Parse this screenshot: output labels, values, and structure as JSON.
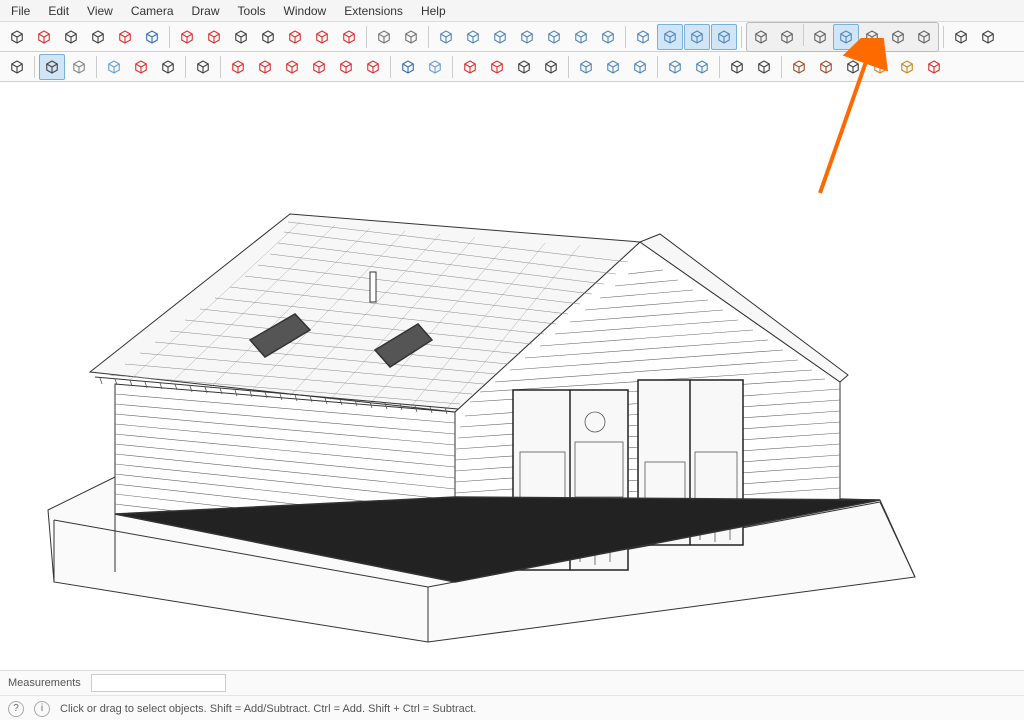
{
  "menu": [
    "File",
    "Edit",
    "View",
    "Camera",
    "Draw",
    "Tools",
    "Window",
    "Extensions",
    "Help"
  ],
  "toolbar1": [
    {
      "name": "select-tool",
      "color": "#444"
    },
    {
      "name": "eraser-crossed-tool",
      "color": "#d33"
    },
    {
      "name": "freehand-tool",
      "color": "#444"
    },
    {
      "name": "text-box-tool",
      "color": "#444"
    },
    {
      "name": "target-tool",
      "color": "#d33"
    },
    {
      "name": "text-a-tool",
      "color": "#3a6fb7"
    },
    {
      "sep": true
    },
    {
      "name": "rotate-prev-tool",
      "color": "#d33"
    },
    {
      "name": "rotate-next-tool",
      "color": "#d33"
    },
    {
      "name": "zoom-in-tool",
      "color": "#444"
    },
    {
      "name": "zoom-target-tool",
      "color": "#444"
    },
    {
      "name": "zoom-extents-tool",
      "color": "#d33"
    },
    {
      "name": "lock-view-tool",
      "color": "#d33"
    },
    {
      "name": "lock-extents-tool",
      "color": "#d33"
    },
    {
      "sep": true
    },
    {
      "name": "walk-tool",
      "color": "#777"
    },
    {
      "name": "person-tool",
      "color": "#777"
    },
    {
      "sep": true
    },
    {
      "name": "cube-tool",
      "color": "#5588bb"
    },
    {
      "name": "panel-tool",
      "color": "#5588bb"
    },
    {
      "name": "house-tool",
      "color": "#5588bb"
    },
    {
      "name": "window-tool",
      "color": "#5588bb"
    },
    {
      "name": "calendar-tool",
      "color": "#5588bb"
    },
    {
      "name": "page-tool",
      "color": "#5588bb"
    },
    {
      "name": "add-page-tool",
      "color": "#5588bb"
    },
    {
      "sep": true
    },
    {
      "name": "sphere-tool",
      "color": "#5588bb"
    },
    {
      "name": "iso-a-tool",
      "active": true,
      "color": "#5588bb"
    },
    {
      "name": "iso-b-tool",
      "active": true,
      "color": "#5588bb"
    },
    {
      "name": "iso-c-tool",
      "active": true,
      "color": "#5588bb"
    },
    {
      "sep": true
    },
    {
      "group": true,
      "items": [
        {
          "name": "solid-wire-tool",
          "color": "#666"
        },
        {
          "name": "solid-hidden-tool",
          "color": "#666"
        },
        {
          "sep": true
        },
        {
          "name": "solid-shade-tool",
          "color": "#666"
        },
        {
          "name": "solid-select-tool",
          "active": true,
          "color": "#5588bb"
        },
        {
          "name": "solid-texture-tool",
          "color": "#666"
        },
        {
          "name": "solid-mono-tool",
          "color": "#666"
        },
        {
          "name": "solid-xray-tool",
          "color": "#666"
        }
      ]
    },
    {
      "sep": true
    },
    {
      "name": "refresh-tool",
      "color": "#444"
    },
    {
      "name": "reload-tool",
      "color": "#444"
    }
  ],
  "toolbar2": [
    {
      "name": "zoom-lens-tool",
      "color": "#444"
    },
    {
      "sep": true
    },
    {
      "name": "pointer-tool",
      "active": true,
      "color": "#444"
    },
    {
      "name": "dropdown-handle",
      "color": "#888"
    },
    {
      "sep": true
    },
    {
      "name": "erase-tool",
      "color": "#6aa0d8"
    },
    {
      "name": "pencil-tool",
      "color": "#d33"
    },
    {
      "name": "bezier-tool",
      "color": "#444"
    },
    {
      "sep": true
    },
    {
      "name": "rect-tool",
      "color": "#444"
    },
    {
      "sep": true
    },
    {
      "name": "pushpull-tool",
      "color": "#d33"
    },
    {
      "name": "followme-tool",
      "color": "#d33"
    },
    {
      "name": "move-tool",
      "color": "#d33"
    },
    {
      "name": "rotate-tool",
      "color": "#d33"
    },
    {
      "name": "scale-tool",
      "color": "#d33"
    },
    {
      "name": "protractor-tool",
      "color": "#d33"
    },
    {
      "sep": true
    },
    {
      "name": "dimension-tool",
      "color": "#3a6fb7"
    },
    {
      "name": "tape-tool",
      "color": "#6aa0d8"
    },
    {
      "sep": true
    },
    {
      "name": "axes-tool",
      "color": "#d33"
    },
    {
      "name": "offset-tool",
      "color": "#d33"
    },
    {
      "name": "zoom-window-tool",
      "color": "#444"
    },
    {
      "name": "zoom-all-tool",
      "color": "#444"
    },
    {
      "sep": true
    },
    {
      "name": "outliner-tool",
      "color": "#5588bb"
    },
    {
      "name": "layers-tool",
      "color": "#5588bb"
    },
    {
      "name": "tags-tool",
      "color": "#5588bb"
    },
    {
      "sep": true
    },
    {
      "name": "component-tool",
      "color": "#5588bb"
    },
    {
      "name": "component-user-tool",
      "color": "#5588bb"
    },
    {
      "sep": true
    },
    {
      "name": "new-doc-tool",
      "color": "#444"
    },
    {
      "name": "user-doc-tool",
      "color": "#444"
    },
    {
      "sep": true
    },
    {
      "name": "library-tool",
      "color": "#a05030"
    },
    {
      "name": "wall-tool",
      "color": "#a05030"
    },
    {
      "name": "cut-tool",
      "color": "#444"
    },
    {
      "name": "paint-tool",
      "color": "#cc8822"
    },
    {
      "name": "export-tool",
      "color": "#cc8822"
    },
    {
      "name": "grid-tool",
      "color": "#d33"
    }
  ],
  "status": {
    "measure_label": "Measurements",
    "measure_value": "",
    "hint": "Click or drag to select objects. Shift = Add/Subtract. Ctrl = Add. Shift + Ctrl = Subtract.",
    "info_icon": "?",
    "help_icon": "i"
  },
  "annotation": {
    "target": "solid-select-tool"
  }
}
